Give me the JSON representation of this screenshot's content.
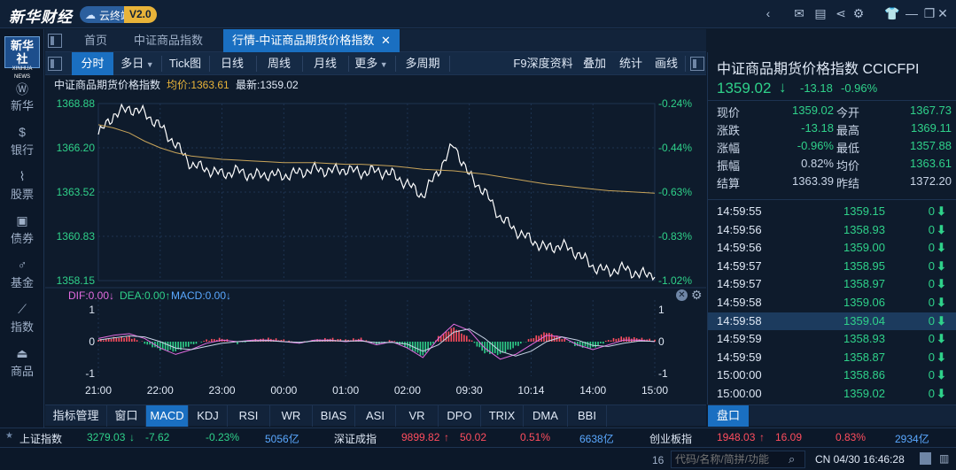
{
  "app": {
    "logo": "新华财经",
    "cloud_label": "云终端",
    "version": "V2.0",
    "top_icons": [
      "chevron-left-icon",
      "mail-icon",
      "chat-icon",
      "share-icon",
      "gear-icon",
      "shirt-icon",
      "minimize-icon",
      "restore-icon",
      "close-icon"
    ]
  },
  "nav": {
    "logo_line1": "新华社",
    "logo_line2": "XINHUA NEWS",
    "items": [
      {
        "label": "新华",
        "icon": "xinhua-icon"
      },
      {
        "label": "银行",
        "icon": "bank-icon"
      },
      {
        "label": "股票",
        "icon": "stock-icon"
      },
      {
        "label": "债券",
        "icon": "bond-icon"
      },
      {
        "label": "基金",
        "icon": "fund-icon"
      },
      {
        "label": "指数",
        "icon": "index-icon"
      },
      {
        "label": "商品",
        "icon": "commodity-icon"
      }
    ]
  },
  "tabs": [
    {
      "label": "首页"
    },
    {
      "label": "中证商品指数"
    },
    {
      "label": "行情-中证商品期货价格指数",
      "close": "✕"
    }
  ],
  "toolbar": {
    "left": [
      "分时",
      "多日",
      "Tick图",
      "日线",
      "周线",
      "月线",
      "更多",
      "多周期"
    ],
    "right": [
      "F9深度资料",
      "叠加",
      "统计",
      "画线"
    ]
  },
  "info": {
    "name": "中证商品期货价格指数",
    "avg_label": "均价:1363.61",
    "last_label": "最新:1359.02"
  },
  "chart_data": [
    {
      "type": "line",
      "series": [
        {
          "name": "",
          "values": [
            1367.0,
            1368.2,
            1368.6,
            1368.3,
            1367.5,
            1366.4,
            1365.2,
            1364.9,
            1364.6,
            1364.8,
            1364.5,
            1364.6,
            1364.5,
            1364.7,
            1364.9,
            1364.8,
            1364.9,
            1364.7,
            1364.8,
            1364.6,
            1364.0,
            1363.3,
            1364.8,
            1366.4,
            1364.5,
            1363.5,
            1362.0,
            1361.2,
            1360.6,
            1360.1,
            1360.3,
            1359.8,
            1359.0,
            1358.7,
            1358.9,
            1358.5,
            1358.6
          ]
        },
        {
          "name": "",
          "values": [
            1367.6,
            1367.4,
            1367.1,
            1366.6,
            1366.2,
            1365.9,
            1365.7,
            1365.6,
            1365.5,
            1365.45,
            1365.4,
            1365.35,
            1365.3,
            1365.3,
            1365.3,
            1365.25,
            1365.2,
            1365.2,
            1365.15,
            1365.1,
            1365.0,
            1364.9,
            1364.85,
            1364.8,
            1364.7,
            1364.6,
            1364.45,
            1364.3,
            1364.15,
            1364.0,
            1363.9,
            1363.8,
            1363.7,
            1363.6,
            1363.55,
            1363.5,
            1363.45
          ]
        }
      ],
      "colors": [
        "#ffffff",
        "#c8a45a"
      ],
      "ylim": [
        1358.15,
        1368.88
      ],
      "y_ticks_left": [
        "1368.88",
        "1366.20",
        "1363.52",
        "1360.83",
        "1358.15"
      ],
      "y_ticks_right": [
        "-0.24%",
        "-0.44%",
        "-0.63%",
        "-0.83%",
        "-1.02%"
      ]
    },
    {
      "type": "bar",
      "legend": [
        {
          "label": "DIF:0.00↓",
          "color": "#e36ce0"
        },
        {
          "label": "DEA:0.00↑",
          "color": "#2fd18a"
        },
        {
          "label": "MACD:0.00↓",
          "color": "#5aa8ff"
        }
      ],
      "values": [
        0.05,
        0.12,
        0.15,
        -0.05,
        -0.25,
        -0.3,
        -0.1,
        0.05,
        0.1,
        -0.05,
        0.05,
        0.1,
        0.05,
        -0.05,
        0.05,
        0.1,
        0.05,
        0.1,
        -0.1,
        0.05,
        -0.2,
        -0.45,
        0.15,
        0.45,
        0.1,
        -0.35,
        -0.4,
        -0.15,
        0.1,
        0.3,
        0.1,
        -0.15,
        -0.2,
        0.05,
        0.15,
        0.1,
        0.05
      ],
      "dif": [
        0.1,
        0.2,
        0.25,
        0.1,
        -0.2,
        -0.4,
        -0.25,
        -0.05,
        0.05,
        0.0,
        0.05,
        0.05,
        0.0,
        -0.05,
        0.05,
        0.05,
        0.0,
        0.05,
        -0.1,
        0.0,
        -0.2,
        -0.5,
        0.1,
        0.55,
        0.35,
        -0.2,
        -0.55,
        -0.4,
        -0.1,
        0.2,
        0.15,
        -0.1,
        -0.25,
        -0.1,
        0.05,
        0.05,
        0.0
      ],
      "dea": [
        0.05,
        0.12,
        0.18,
        0.15,
        0.0,
        -0.2,
        -0.25,
        -0.15,
        -0.05,
        0.0,
        0.02,
        0.03,
        0.0,
        -0.02,
        0.02,
        0.03,
        0.02,
        0.02,
        -0.03,
        -0.02,
        -0.08,
        -0.3,
        -0.1,
        0.3,
        0.4,
        0.1,
        -0.3,
        -0.45,
        -0.3,
        0.0,
        0.15,
        0.05,
        -0.12,
        -0.15,
        -0.05,
        0.02,
        0.01
      ],
      "ylim": [
        -1,
        1
      ],
      "y_ticks": [
        "1",
        "0",
        "-1"
      ],
      "x_ticks": [
        "21:00",
        "22:00",
        "23:00",
        "00:00",
        "01:00",
        "02:00",
        "09:30",
        "10:14",
        "14:00",
        "15:00"
      ]
    }
  ],
  "right": {
    "title": "中证商品期货价格指数 CCICFPI",
    "price": "1359.02",
    "arrow": "↓",
    "change": "-13.18",
    "pct": "-0.96%",
    "stats": [
      {
        "l1": "现价",
        "v1": "1359.02",
        "l2": "今开",
        "v2": "1367.73",
        "c1": "dn",
        "c2": "dn"
      },
      {
        "l1": "涨跌",
        "v1": "-13.18",
        "l2": "最高",
        "v2": "1369.11",
        "c1": "dn",
        "c2": "dn"
      },
      {
        "l1": "涨幅",
        "v1": "-0.96%",
        "l2": "最低",
        "v2": "1357.88",
        "c1": "dn",
        "c2": "dn"
      },
      {
        "l1": "振幅",
        "v1": "0.82%",
        "l2": "均价",
        "v2": "1363.61",
        "c1": "wh",
        "c2": "dn"
      },
      {
        "l1": "结算",
        "v1": "1363.39",
        "l2": "昨结",
        "v2": "1372.20",
        "c1": "wh",
        "c2": "wh"
      }
    ],
    "ticks": [
      {
        "t": "14:59:55",
        "p": "1359.15",
        "v": "0"
      },
      {
        "t": "14:59:56",
        "p": "1358.93",
        "v": "0"
      },
      {
        "t": "14:59:56",
        "p": "1359.00",
        "v": "0"
      },
      {
        "t": "14:59:57",
        "p": "1358.95",
        "v": "0"
      },
      {
        "t": "14:59:57",
        "p": "1358.97",
        "v": "0"
      },
      {
        "t": "14:59:58",
        "p": "1359.06",
        "v": "0"
      },
      {
        "t": "14:59:58",
        "p": "1359.04",
        "v": "0",
        "hl": true
      },
      {
        "t": "14:59:59",
        "p": "1358.93",
        "v": "0"
      },
      {
        "t": "14:59:59",
        "p": "1358.87",
        "v": "0"
      },
      {
        "t": "15:00:00",
        "p": "1358.86",
        "v": "0"
      },
      {
        "t": "15:00:00",
        "p": "1359.02",
        "v": "0"
      }
    ],
    "tab": "盘口"
  },
  "bottom_tabs": [
    "指标管理",
    "窗口",
    "MACD",
    "KDJ",
    "RSI",
    "WR",
    "BIAS",
    "ASI",
    "VR",
    "DPO",
    "TRIX",
    "DMA",
    "BBI"
  ],
  "ticker": [
    {
      "name": "上证指数",
      "price": "3279.03",
      "arrow": "↓",
      "chg": "-7.62",
      "pct": "-0.23%",
      "vol": "5056亿",
      "dir": "dn"
    },
    {
      "name": "深证成指",
      "price": "9899.82",
      "arrow": "↑",
      "chg": "50.02",
      "pct": "0.51%",
      "vol": "6638亿",
      "dir": "up"
    },
    {
      "name": "创业板指",
      "price": "1948.03",
      "arrow": "↑",
      "chg": "16.09",
      "pct": "0.83%",
      "vol": "2934亿",
      "dir": "up"
    }
  ],
  "status": {
    "search_placeholder": "代码/名称/简拼/功能",
    "clock": "CN 04/30 16:46:28",
    "left_clip": "16"
  }
}
